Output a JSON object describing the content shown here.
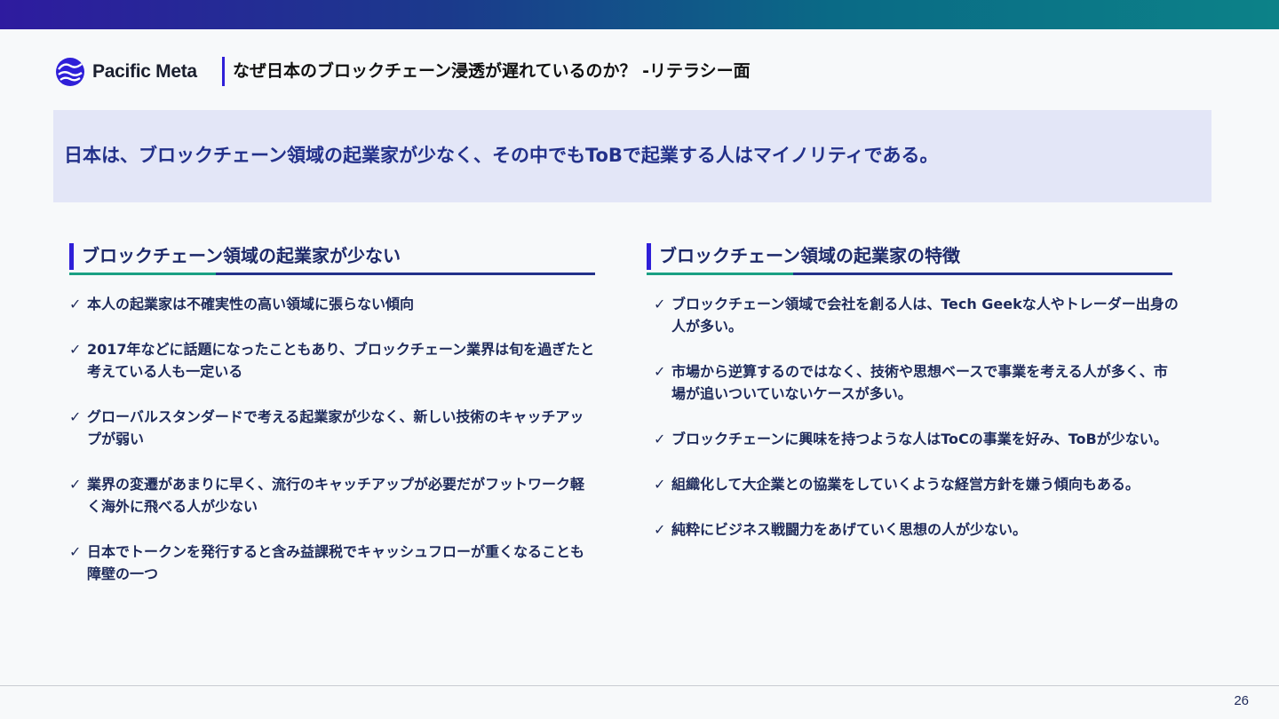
{
  "header": {
    "brand": "Pacific Meta",
    "title": "なぜ日本のブロックチェーン浸透が遅れているのか？ -リテラシー面"
  },
  "banner": {
    "text": "日本は、ブロックチェーン領域の起業家が少なく、その中でもToBで起業する人はマイノリティである。"
  },
  "left_section": {
    "title": "ブロックチェーン領域の起業家が少ない",
    "items": [
      "本人の起業家は不確実性の高い領域に張らない傾向",
      "2017年などに話題になったこともあり、ブロックチェーン業界は旬を過ぎたと考えている人も一定いる",
      "グローバルスタンダードで考える起業家が少なく、新しい技術のキャッチアップが弱い",
      "業界の変遷があまりに早く、流行のキャッチアップが必要だがフットワーク軽く海外に飛べる人が少ない",
      "日本でトークンを発行すると含み益課税でキャッシュフローが重くなることも障壁の一つ"
    ]
  },
  "right_section": {
    "title": "ブロックチェーン領域の起業家の特徴",
    "items": [
      "ブロックチェーン領域で会社を創る人は、Tech Geekな人やトレーダー出身の人が多い。",
      "市場から逆算するのではなく、技術や思想ベースで事業を考える人が多く、市場が追いついていないケースが多い。",
      "ブロックチェーンに興味を持つような人はToCの事業を好み、ToBが少ない。",
      "組織化して大企業との協業をしていくような経営方針を嫌う傾向もある。",
      "純粋にビジネス戦闘力をあげていく思想の人が少ない。"
    ]
  },
  "check_symbol": "✓",
  "footer": {
    "page_number": "26"
  },
  "colors": {
    "accent_blue": "#2f1fd8",
    "navy": "#23318a",
    "teal": "#1aa083",
    "banner_bg": "#e3e6f7"
  }
}
